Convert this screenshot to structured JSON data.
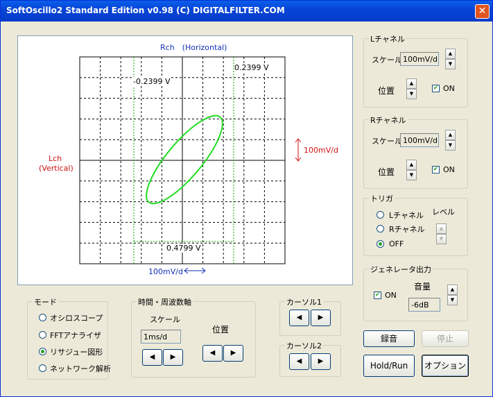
{
  "window": {
    "title": "SoftOscillo2 Standard Edition v0.98 (C) DIGITALFILTER.COM",
    "close_label": "✕"
  },
  "scope": {
    "top_label": "Rch　(Horizontal)",
    "left_label_1": "Lch",
    "left_label_2": "(Vertical)",
    "right_scale": "100mV/d",
    "bottom_scale": "100mV/d",
    "cursor_top_right": "0.2399 V",
    "cursor_top_left": "-0.2399 V",
    "cursor_bottom": "0.4799 V",
    "trace_color": "#22DD22",
    "grid_color": "#000000",
    "cursor_color": "#00AA00"
  },
  "lch": {
    "title": "Lチャネル",
    "scale_label": "スケール",
    "scale_value": "100mV/d",
    "pos_label": "位置",
    "on_label": "ON",
    "on": true
  },
  "rch": {
    "title": "Rチャネル",
    "scale_label": "スケール",
    "scale_value": "100mV/d",
    "pos_label": "位置",
    "on_label": "ON",
    "on": true
  },
  "trigger": {
    "title": "トリガ",
    "options": [
      "Lチャネル",
      "Rチャネル",
      "OFF"
    ],
    "selected": 2,
    "level_label": "レベル"
  },
  "generator": {
    "title": "ジェネレータ出力",
    "on_label": "ON",
    "on": true,
    "volume_label": "音量",
    "volume_value": "-6dB"
  },
  "mode": {
    "title": "モード",
    "options": [
      "オシロスコープ",
      "FFTアナライザ",
      "リサジュー図形",
      "ネットワーク解析"
    ],
    "selected": 2
  },
  "timefreq": {
    "title": "時間・周波数軸",
    "scale_label": "スケール",
    "scale_value": "1ms/d",
    "pos_label": "位置"
  },
  "cursor1": {
    "title": "カーソル1"
  },
  "cursor2": {
    "title": "カーソル2"
  },
  "buttons": {
    "record": "録音",
    "stop": "停止",
    "holdrun": "Hold/Run",
    "option": "オプション"
  },
  "icons": {
    "left": "◀",
    "right": "▶",
    "up": "▲",
    "down": "▼",
    "check": "✔"
  }
}
